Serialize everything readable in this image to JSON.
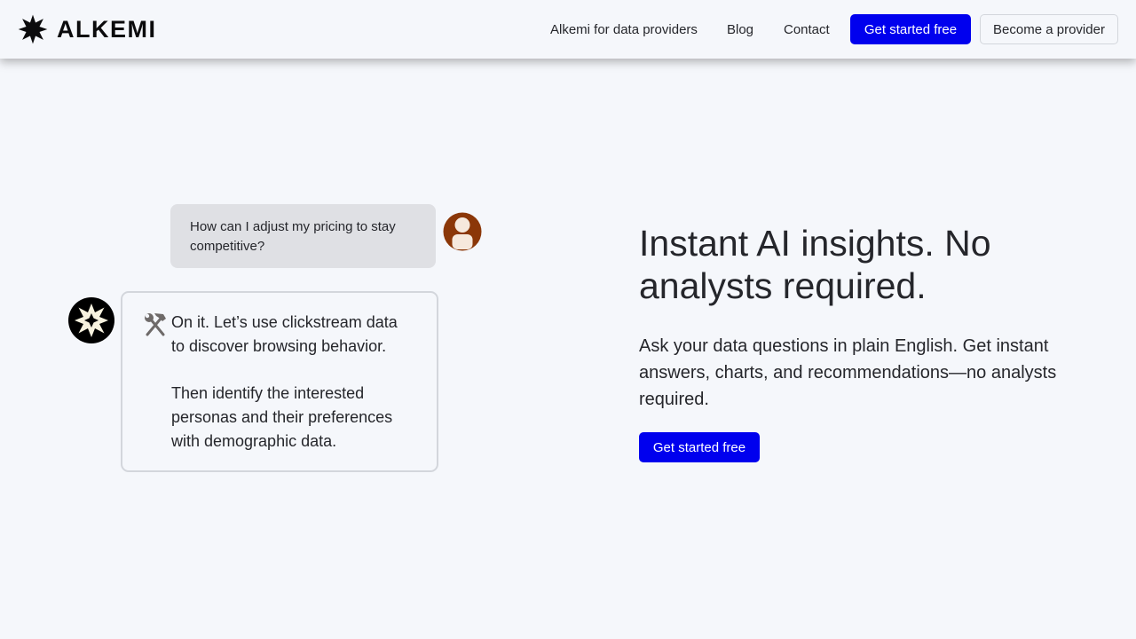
{
  "header": {
    "logo_text": "ALKEMI",
    "nav": {
      "data_providers": "Alkemi for data providers",
      "blog": "Blog",
      "contact": "Contact"
    },
    "cta_primary": "Get started free",
    "cta_secondary": "Become a provider"
  },
  "chat": {
    "user_message": "How can I adjust my pricing to stay competitive?",
    "ai_message_1": "On it. Let’s use clickstream data to discover browsing behavior.",
    "ai_message_2": "Then identify the interested personas and their preferences with demographic data."
  },
  "hero": {
    "title": "Instant AI insights. No analysts required.",
    "subtitle": "Ask your data questions in plain English. Get instant answers, charts, and recommendations—no analysts required.",
    "cta": "Get started free"
  },
  "colors": {
    "accent": "#0000ee",
    "background": "#f5f7fb",
    "user_avatar": "#8b3708",
    "text": "#25262b"
  },
  "icons": {
    "logo": "star-burst-icon",
    "user_avatar": "user-avatar-icon",
    "assistant_avatar": "alkemi-avatar-icon",
    "tools": "hammer-wrench-icon"
  }
}
